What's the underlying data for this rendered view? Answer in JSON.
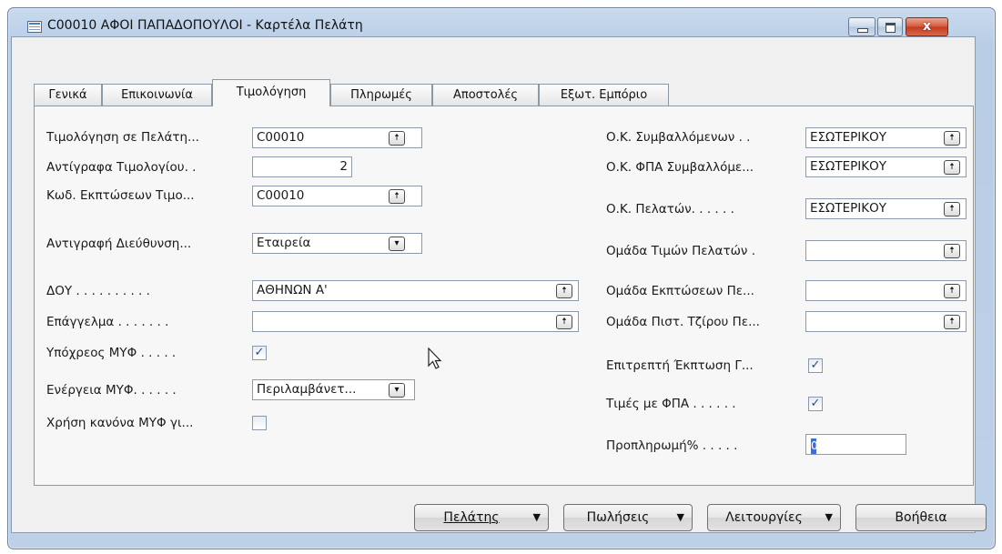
{
  "window": {
    "title": "C00010 ΑΦΟΙ ΠΑΠΑΔΟΠΟΥΛΟΙ - Καρτέλα Πελάτη",
    "close_symbol": "x"
  },
  "tabs": [
    "Γενικά",
    "Επικοινωνία",
    "Τιμολόγηση",
    "Πληρωμές",
    "Αποστολές",
    "Εξωτ. Εμπόριο"
  ],
  "active_tab": "Τιμολόγηση",
  "left": {
    "bill_to_label": "Τιμολόγηση σε Πελάτη...",
    "bill_to_value": "C00010",
    "invoice_copies_label": "Αντίγραφα Τιμολογίου. .",
    "invoice_copies_value": "2",
    "invoice_disc_label": "Κωδ. Εκπτώσεων Τιμο...",
    "invoice_disc_value": "C00010",
    "copy_address_label": "Αντιγραφή Διεύθυνση...",
    "copy_address_value": "Εταιρεία",
    "doy_label": "ΔΟΥ . . . . . . . . . .",
    "doy_value": "ΑΘΗΝΩΝ Α'",
    "profession_label": "Επάγγελμα . . . . . . .",
    "profession_value": "",
    "vat_liable_label": "Υπόχρεος ΜΥΦ . . . . .",
    "vat_liable_checked": true,
    "vat_action_label": "Ενέργεια ΜΥΦ. . . . . .",
    "vat_action_value": "Περιλαμβάνετ...",
    "vat_rule_label": "Χρήση κανόνα ΜΥΦ γι...",
    "vat_rule_checked": false
  },
  "right": {
    "gen_bus_posting_label": "Ο.Κ. Συμβαλλόμενων . .",
    "gen_bus_posting_value": "ΕΣΩΤΕΡΙΚΟΥ",
    "vat_bus_posting_label": "Ο.Κ. ΦΠΑ Συμβαλλόμε...",
    "vat_bus_posting_value": "ΕΣΩΤΕΡΙΚΟΥ",
    "customer_posting_label": "Ο.Κ. Πελατών. . . . . .",
    "customer_posting_value": "ΕΣΩΤΕΡΙΚΟΥ",
    "price_group_label": "Ομάδα Τιμών Πελατών  .",
    "price_group_value": "",
    "disc_group_label": "Ομάδα Εκπτώσεων Πε...",
    "disc_group_value": "",
    "credit_group_label": "Ομάδα Πιστ. Τζίρου Πε...",
    "credit_group_value": "",
    "allow_line_disc_label": "Επιτρεπτή Έκπτωση Γ...",
    "allow_line_disc_checked": true,
    "prices_incl_vat_label": "Τιμές με ΦΠΑ . . . . . .",
    "prices_incl_vat_checked": true,
    "prepayment_label": "Προπληρωμή% . . . . .",
    "prepayment_value": "0"
  },
  "buttons": {
    "customer": "Πελάτης",
    "sales": "Πωλήσεις",
    "functions": "Λειτουργίες",
    "help": "Βοήθεια"
  },
  "icons": {
    "lookup": "up-arrow-icon",
    "dropdown": "down-arrow-icon",
    "checkbox_mark": "✓"
  }
}
